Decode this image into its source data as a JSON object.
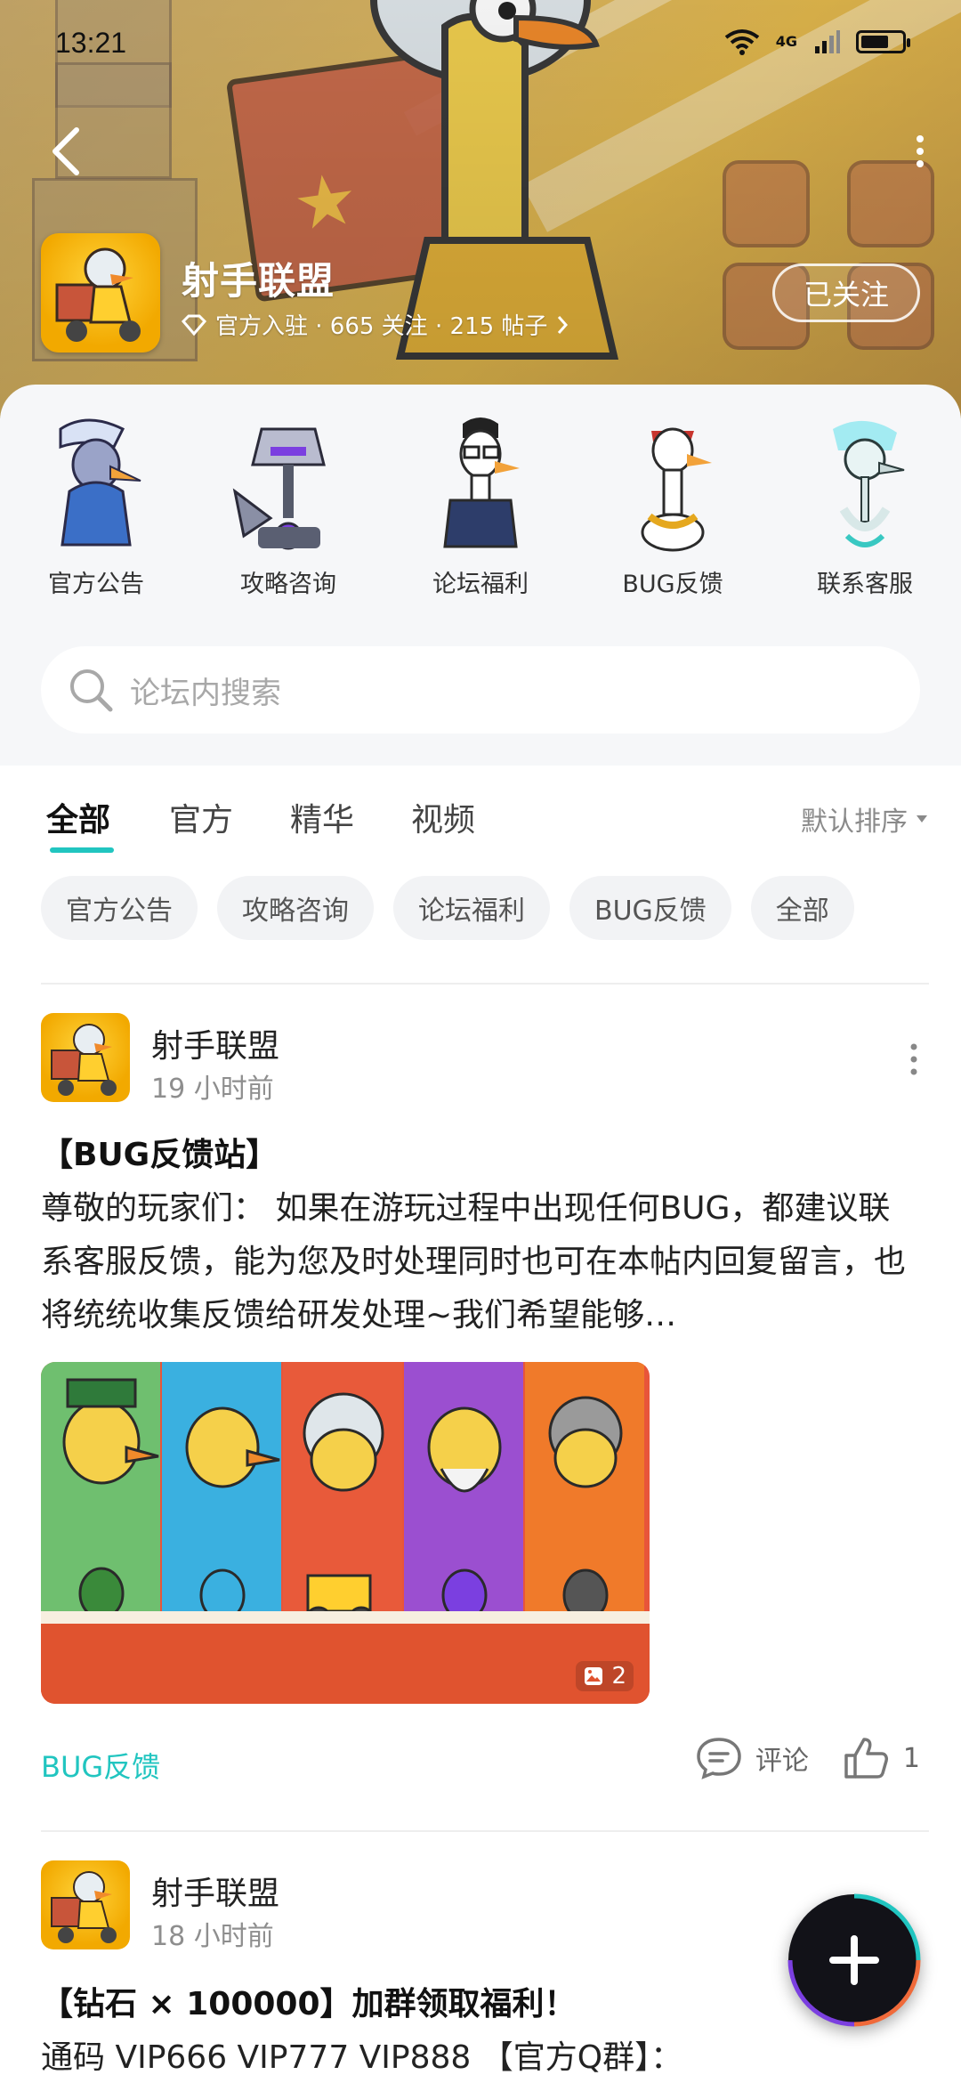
{
  "status_bar": {
    "time": "13:21",
    "network": "4G"
  },
  "forum": {
    "name": "射手联盟",
    "meta": "官方入驻 · 665 关注 · 215 帖子",
    "follow_label": "已关注"
  },
  "quick_nav": [
    {
      "label": "官方公告",
      "icon": "pelican-character"
    },
    {
      "label": "攻略咨询",
      "icon": "robot-character"
    },
    {
      "label": "论坛福利",
      "icon": "goose-glasses-character"
    },
    {
      "label": "BUG反馈",
      "icon": "goose-headband-character"
    },
    {
      "label": "联系客服",
      "icon": "skeleton-character"
    }
  ],
  "search": {
    "placeholder": "论坛内搜索"
  },
  "tabs": [
    {
      "label": "全部",
      "active": true
    },
    {
      "label": "官方",
      "active": false
    },
    {
      "label": "精华",
      "active": false
    },
    {
      "label": "视频",
      "active": false
    }
  ],
  "sort_label": "默认排序",
  "chips": [
    "官方公告",
    "攻略咨询",
    "论坛福利",
    "BUG反馈",
    "全部"
  ],
  "posts": [
    {
      "author": "射手联盟",
      "time": "19 小时前",
      "title": "【BUG反馈站】",
      "body": "尊敬的玩家们：  如果在游玩过程中出现任何BUG，都建议联系客服反馈，能为您及时处理同时也可在本帖内回复留言，也将统统收集反馈给研发处理~我们希望能够…",
      "image_count": "2",
      "tag": "BUG反馈",
      "comment_label": "评论",
      "like_count": "1"
    },
    {
      "author": "射手联盟",
      "time": "18 小时前",
      "title": "【钻石 × 100000】加群领取福利！",
      "body": "通码 VIP666 VIP777 VIP888 【官方Q群】："
    }
  ],
  "colors": {
    "accent": "#21c5c0",
    "banner": "#d9b45e",
    "fab": "#121218"
  }
}
